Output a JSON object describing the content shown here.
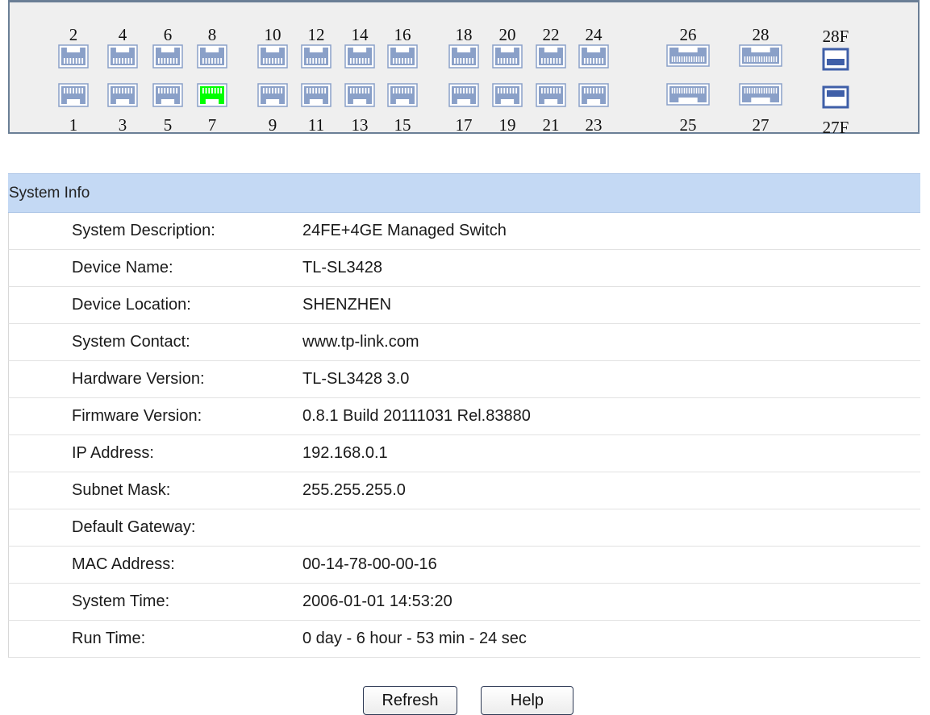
{
  "ports": {
    "top": [
      {
        "label": "2",
        "link": false
      },
      {
        "label": "4",
        "link": false
      },
      {
        "label": "6",
        "link": false
      },
      {
        "label": "8",
        "link": false
      },
      {
        "label": "10",
        "link": false
      },
      {
        "label": "12",
        "link": false
      },
      {
        "label": "14",
        "link": false
      },
      {
        "label": "16",
        "link": false
      },
      {
        "label": "18",
        "link": false
      },
      {
        "label": "20",
        "link": false
      },
      {
        "label": "22",
        "link": false
      },
      {
        "label": "24",
        "link": false
      },
      {
        "label": "26",
        "link": false
      },
      {
        "label": "28",
        "link": false
      }
    ],
    "bottom": [
      {
        "label": "1",
        "link": false
      },
      {
        "label": "3",
        "link": false
      },
      {
        "label": "5",
        "link": false
      },
      {
        "label": "7",
        "link": true
      },
      {
        "label": "9",
        "link": false
      },
      {
        "label": "11",
        "link": false
      },
      {
        "label": "13",
        "link": false
      },
      {
        "label": "15",
        "link": false
      },
      {
        "label": "17",
        "link": false
      },
      {
        "label": "19",
        "link": false
      },
      {
        "label": "21",
        "link": false
      },
      {
        "label": "23",
        "link": false
      },
      {
        "label": "25",
        "link": false
      },
      {
        "label": "27",
        "link": false
      }
    ],
    "sfp": [
      {
        "label": "28F",
        "link": false
      },
      {
        "label": "27F",
        "link": false
      }
    ],
    "colors": {
      "port_idle": "#8aa0c8",
      "port_link": "#00ff00",
      "sfp": "#3f5fa8"
    }
  },
  "system_info": {
    "title": "System Info",
    "rows": [
      {
        "label": "System Description:",
        "value": "24FE+4GE Managed Switch"
      },
      {
        "label": "Device Name:",
        "value": "TL-SL3428"
      },
      {
        "label": "Device Location:",
        "value": "SHENZHEN"
      },
      {
        "label": "System Contact:",
        "value": "www.tp-link.com"
      },
      {
        "label": "Hardware Version:",
        "value": "TL-SL3428 3.0"
      },
      {
        "label": "Firmware Version:",
        "value": "0.8.1 Build 20111031 Rel.83880"
      },
      {
        "label": "IP Address:",
        "value": "192.168.0.1"
      },
      {
        "label": "Subnet Mask:",
        "value": "255.255.255.0"
      },
      {
        "label": "Default Gateway:",
        "value": ""
      },
      {
        "label": "MAC Address:",
        "value": "00-14-78-00-00-16"
      },
      {
        "label": "System Time:",
        "value": "2006-01-01 14:53:20"
      },
      {
        "label": "Run Time:",
        "value": "0 day - 6 hour - 53 min - 24 sec"
      }
    ]
  },
  "buttons": {
    "refresh": "Refresh",
    "help": "Help"
  }
}
